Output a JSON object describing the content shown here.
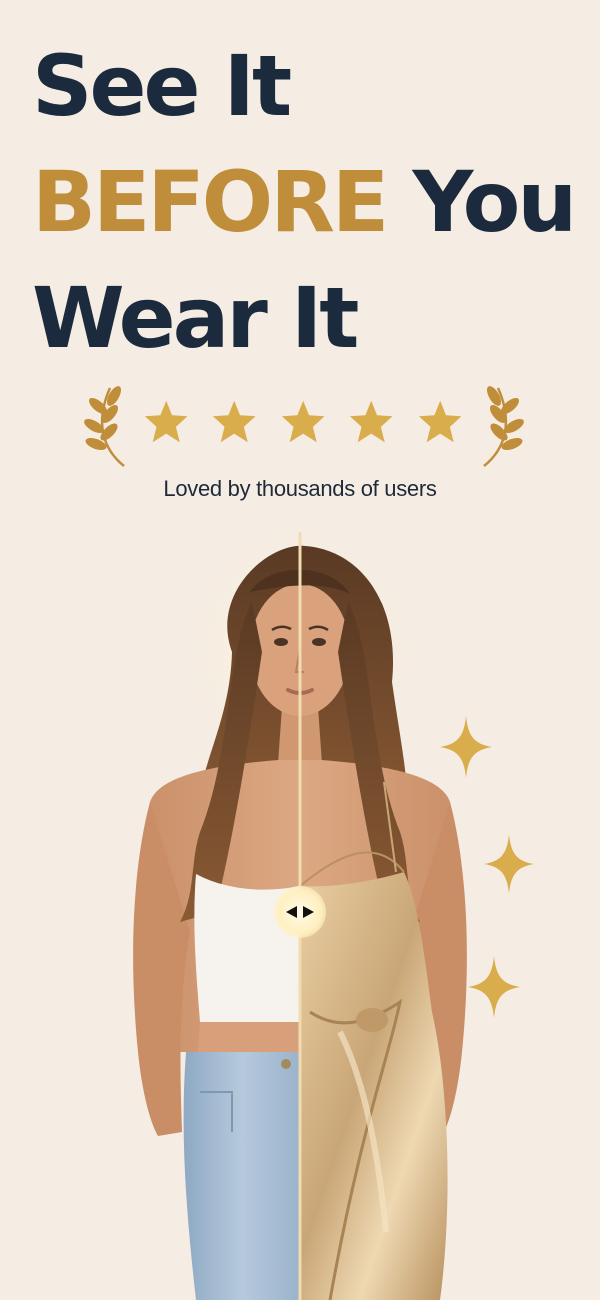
{
  "headline": {
    "line1": "See It",
    "line2_accent": "BEFORE",
    "line2_rest": "You",
    "line3": "Wear It"
  },
  "rating": {
    "stars": 5,
    "tagline": "Loved by thousands of users"
  },
  "colors": {
    "background": "#f5ece3",
    "navy": "#1c2a3d",
    "gold": "#c08e3b",
    "star_gold": "#d9ac4c"
  },
  "comparison": {
    "split_percent": 50,
    "before_label": "white crop top and light-wash jeans",
    "after_label": "champagne satin wrap dress"
  },
  "icons": {
    "laurel": "laurel-branch-icon",
    "star": "star-icon",
    "handle": "left-right-arrows-icon",
    "sparkle": "sparkle-icon"
  }
}
